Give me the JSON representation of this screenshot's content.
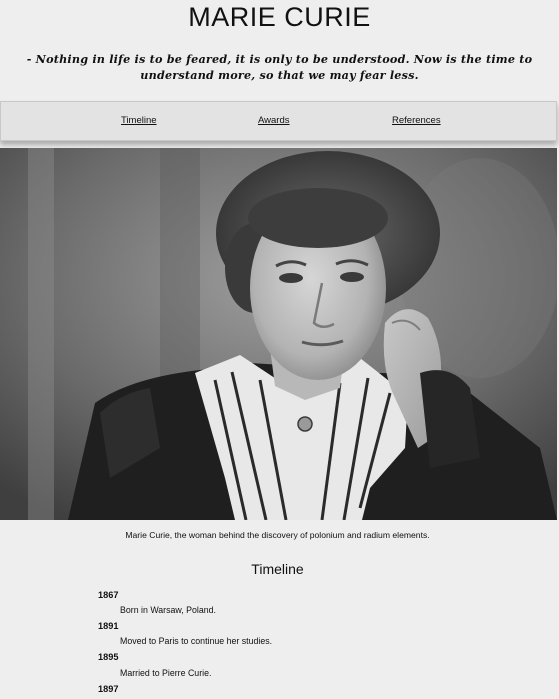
{
  "header": {
    "title": "MARIE CURIE",
    "quote": "- Nothing in life is to be feared, it is only to be understood. Now is the time to understand more, so that we may fear less."
  },
  "nav": {
    "links": [
      "Timeline",
      "Awards",
      "References"
    ]
  },
  "figure": {
    "caption": "Marie Curie, the woman behind the discovery of polonium and radium elements."
  },
  "timeline": {
    "heading": "Timeline",
    "items": [
      {
        "year": "1867",
        "event": "Born in Warsaw, Poland."
      },
      {
        "year": "1891",
        "event": "Moved to Paris to continue her studies."
      },
      {
        "year": "1895",
        "event": "Married to Pierre Curie."
      },
      {
        "year": "1897",
        "event": ""
      }
    ]
  }
}
